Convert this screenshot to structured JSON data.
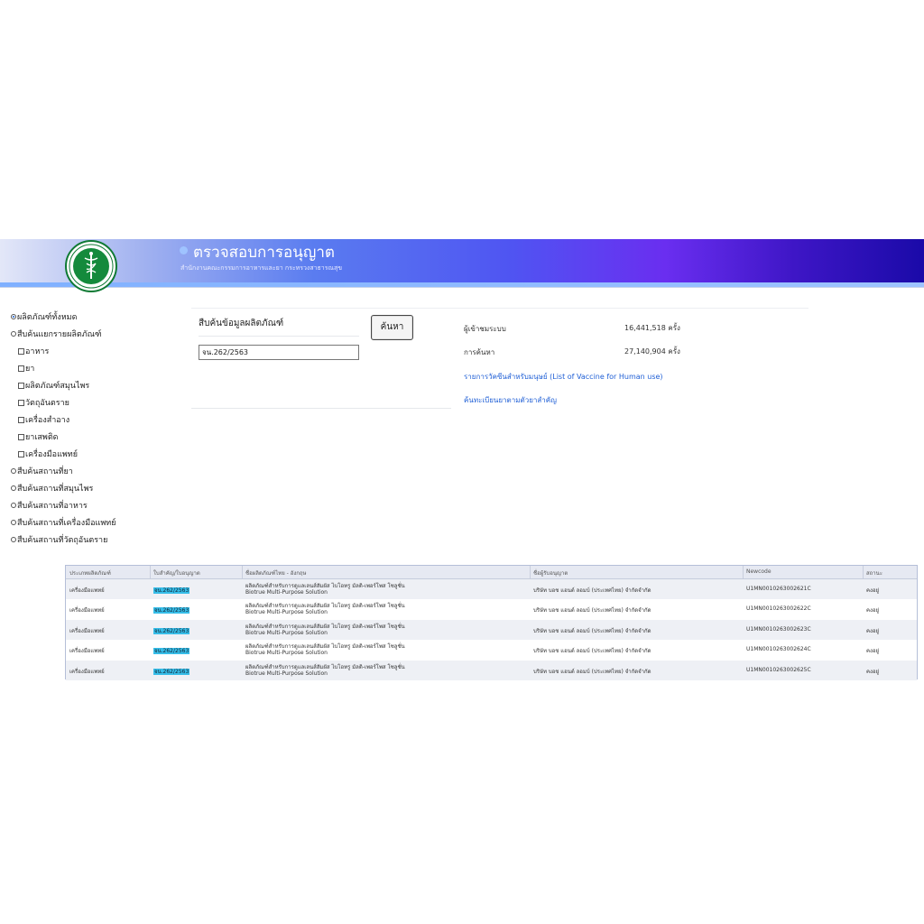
{
  "header": {
    "title": "ตรวจสอบการอนุญาต",
    "subtitle": "สำนักงานคณะกรรมการอาหารและยา กระทรวงสาธารณสุข"
  },
  "options": [
    {
      "label": "ผลิตภัณฑ์ทั้งหมด",
      "type": "radio",
      "checked": true
    },
    {
      "label": "สืบค้นแยกรายผลิตภัณฑ์",
      "type": "radio",
      "checked": false
    },
    {
      "label": "อาหาร",
      "type": "checkbox",
      "checked": false
    },
    {
      "label": "ยา",
      "type": "checkbox",
      "checked": false
    },
    {
      "label": "ผลิตภัณฑ์สมุนไพร",
      "type": "checkbox",
      "checked": false
    },
    {
      "label": "วัตถุอันตราย",
      "type": "checkbox",
      "checked": false
    },
    {
      "label": "เครื่องสำอาง",
      "type": "checkbox",
      "checked": false
    },
    {
      "label": "ยาเสพติด",
      "type": "checkbox",
      "checked": false
    },
    {
      "label": "เครื่องมือแพทย์",
      "type": "checkbox",
      "checked": false
    },
    {
      "label": "สืบค้นสถานที่ยา",
      "type": "radio",
      "checked": false
    },
    {
      "label": "สืบค้นสถานที่สมุนไพร",
      "type": "radio",
      "checked": false
    },
    {
      "label": "สืบค้นสถานที่อาหาร",
      "type": "radio",
      "checked": false
    },
    {
      "label": "สืบค้นสถานที่เครื่องมือแพทย์",
      "type": "radio",
      "checked": false
    },
    {
      "label": "สืบค้นสถานที่วัตถุอันตราย",
      "type": "radio",
      "checked": false
    }
  ],
  "search": {
    "label": "สืบค้นข้อมูลผลิตภัณฑ์",
    "value": "จน.262/2563",
    "button": "ค้นหา"
  },
  "stats": {
    "visitors_label": "ผู้เข้าชมระบบ",
    "visitors_value": "16,441,518 ครั้ง",
    "searches_label": "การค้นหา",
    "searches_value": "27,140,904 ครั้ง",
    "vaccine_link": "รายการวัคซีนสำหรับมนุษย์ (List of Vaccine for Human use)",
    "check_link": "ค้นทะเบียนยาตามตัวยาสำคัญ"
  },
  "table": {
    "headers": [
      "ประเภทผลิตภัณฑ์",
      "ใบสำคัญ/ใบอนุญาต",
      "ชื่อผลิตภัณฑ์ไทย - อังกฤษ",
      "ชื่อผู้รับอนุญาต",
      "Newcode",
      "สถานะ"
    ],
    "rows": [
      {
        "type": "เครื่องมือแพทย์",
        "license": "จน.262/2563",
        "name_th": "ผลิตภัณฑ์สำหรับการดูแลเลนส์สัมผัส ไบโอทรู มัลติ-เพอร์โพส โซลูชั่น",
        "name_en": "Biotrue Multi-Purpose Solution",
        "holder": "บริษัท บอช แอนด์ ลอมบ์ (ประเทศไทย) จำกัดจำกัด",
        "newcode": "U1MN0010263002621C",
        "status": "คงอยู่"
      },
      {
        "type": "เครื่องมือแพทย์",
        "license": "จน.262/2563",
        "name_th": "ผลิตภัณฑ์สำหรับการดูแลเลนส์สัมผัส ไบโอทรู มัลติ-เพอร์โพส โซลูชั่น",
        "name_en": "Biotrue Multi-Purpose Solution",
        "holder": "บริษัท บอช แอนด์ ลอมบ์ (ประเทศไทย) จำกัดจำกัด",
        "newcode": "U1MN0010263002622C",
        "status": "คงอยู่"
      },
      {
        "type": "เครื่องมือแพทย์",
        "license": "จน.262/2563",
        "name_th": "ผลิตภัณฑ์สำหรับการดูแลเลนส์สัมผัส ไบโอทรู มัลติ-เพอร์โพส โซลูชั่น",
        "name_en": "Biotrue Multi-Purpose Solution",
        "holder": "บริษัท บอช แอนด์ ลอมบ์ (ประเทศไทย) จำกัดจำกัด",
        "newcode": "U1MN0010263002623C",
        "status": "คงอยู่"
      },
      {
        "type": "เครื่องมือแพทย์",
        "license": "จน.262/2563",
        "name_th": "ผลิตภัณฑ์สำหรับการดูแลเลนส์สัมผัส ไบโอทรู มัลติ-เพอร์โพส โซลูชั่น",
        "name_en": "Biotrue Multi-Purpose Solution",
        "holder": "บริษัท บอช แอนด์ ลอมบ์ (ประเทศไทย) จำกัดจำกัด",
        "newcode": "U1MN0010263002624C",
        "status": "คงอยู่"
      },
      {
        "type": "เครื่องมือแพทย์",
        "license": "จน.262/2563",
        "name_th": "ผลิตภัณฑ์สำหรับการดูแลเลนส์สัมผัส ไบโอทรู มัลติ-เพอร์โพส โซลูชั่น",
        "name_en": "Biotrue Multi-Purpose Solution",
        "holder": "บริษัท บอช แอนด์ ลอมบ์ (ประเทศไทย) จำกัดจำกัด",
        "newcode": "U1MN0010263002625C",
        "status": "คงอยู่"
      }
    ]
  },
  "colors": {
    "link": "#1f5fd6",
    "highlight": "#36bde8",
    "banner_end": "#1a0aa8",
    "logo_green": "#148a3c"
  },
  "icons": [
    "ministry-of-public-health-logo"
  ]
}
